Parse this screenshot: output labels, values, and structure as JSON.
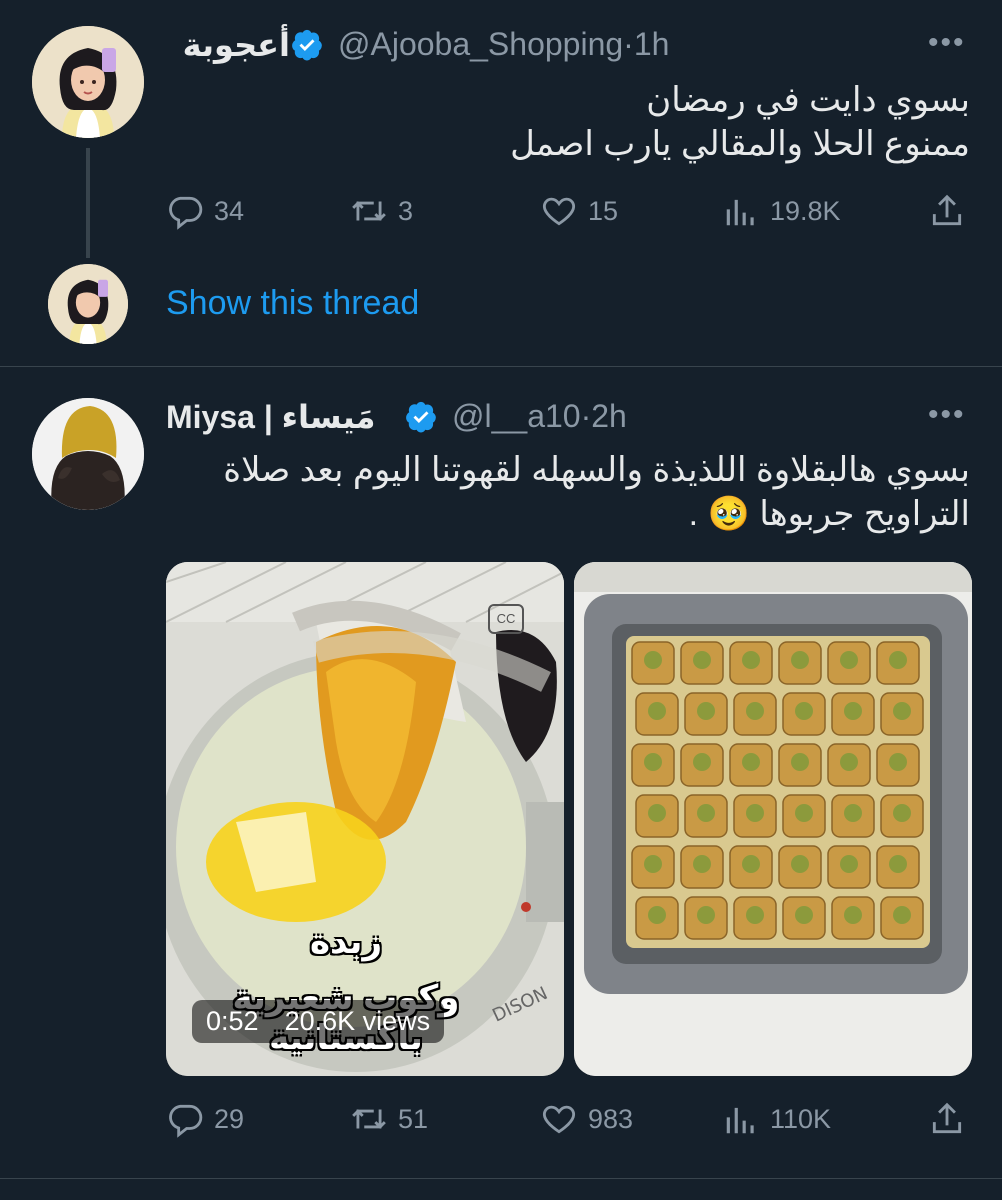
{
  "tweet1": {
    "author_name": "أعجوبة",
    "handle": "@Ajooba_Shopping",
    "time": "1h",
    "text_line1": "بسوي دايت في رمضان",
    "text_line2": "ممنوع الحلا والمقالي يارب اصمل",
    "replies": "34",
    "retweets": "3",
    "likes": "15",
    "views": "19.8K"
  },
  "thread_link": "Show this thread",
  "tweet2": {
    "author_name": "Miysa | مَيساء",
    "handle": "@l__a10",
    "time": "2h",
    "text_line1": "بسوي هالبقلاوة اللذيذة والسهله لقهوتنا اليوم بعد صلاة",
    "text_line2": "التراويح جربوها 🥹 .",
    "video_time": "0:52",
    "video_views": "20.6K views",
    "video_caption": [
      "زبدة",
      "وكوب شعيرية",
      "باكستانية"
    ],
    "pan_brand": "DISON",
    "replies": "29",
    "retweets": "51",
    "likes": "983",
    "views": "110K"
  },
  "colors": {
    "background": "#15202b",
    "text": "#e7e9ea",
    "muted": "#8b98a5",
    "link": "#1d9bf0",
    "verified": "#1d9bf0"
  },
  "icons": [
    "reply-icon",
    "retweet-icon",
    "like-icon",
    "views-icon",
    "share-icon",
    "verified-icon",
    "more-icon",
    "captions-icon"
  ]
}
